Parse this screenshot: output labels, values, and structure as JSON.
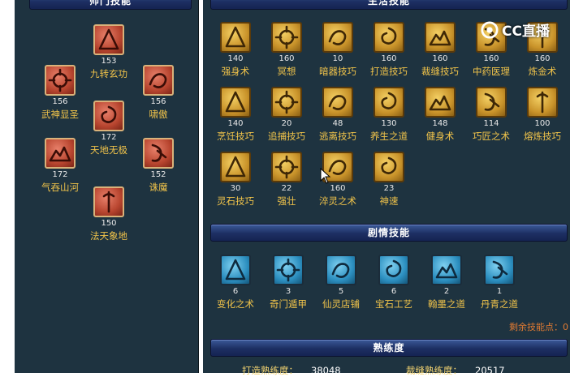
{
  "headers": {
    "school_skills": "师门技能",
    "life_skills": "生活技能",
    "story_skills": "剧情技能",
    "proficiency": "熟练度"
  },
  "school_skills": [
    {
      "level": "153",
      "name": "九转玄功",
      "icon": "spike-icon"
    },
    {
      "level": "156",
      "name": "武神显圣",
      "icon": "burst-icon"
    },
    {
      "level": "156",
      "name": "啸傲",
      "icon": "dragon-icon"
    },
    {
      "level": "172",
      "name": "天地无极",
      "icon": "vortex-icon"
    },
    {
      "level": "172",
      "name": "气吞山河",
      "icon": "mountain-icon"
    },
    {
      "level": "152",
      "name": "诛魔",
      "icon": "claw-icon"
    },
    {
      "level": "150",
      "name": "法天象地",
      "icon": "staff-icon"
    }
  ],
  "life_skills": [
    {
      "level": "140",
      "name": "强身术",
      "icon": "body-icon"
    },
    {
      "level": "160",
      "name": "冥想",
      "icon": "meditate-icon"
    },
    {
      "level": "10",
      "name": "暗器技巧",
      "icon": "dart-icon"
    },
    {
      "level": "160",
      "name": "打造技巧",
      "icon": "forge-icon"
    },
    {
      "level": "160",
      "name": "裁缝技巧",
      "icon": "scissors-icon"
    },
    {
      "level": "160",
      "name": "中药医理",
      "icon": "herb-icon"
    },
    {
      "level": "160",
      "name": "炼金术",
      "icon": "flask-icon"
    },
    {
      "level": "140",
      "name": "烹饪技巧",
      "icon": "pot-icon"
    },
    {
      "level": "20",
      "name": "追捕技巧",
      "icon": "chain-icon"
    },
    {
      "level": "48",
      "name": "逃离技巧",
      "icon": "escape-icon"
    },
    {
      "level": "130",
      "name": "养生之道",
      "icon": "figure-icon"
    },
    {
      "level": "148",
      "name": "健身术",
      "icon": "muscle-icon"
    },
    {
      "level": "114",
      "name": "巧匠之术",
      "icon": "tool-icon"
    },
    {
      "level": "100",
      "name": "熔炼技巧",
      "icon": "furnace-icon"
    },
    {
      "level": "30",
      "name": "灵石技巧",
      "icon": "gem-icon"
    },
    {
      "level": "22",
      "name": "强壮",
      "icon": "strong-icon"
    },
    {
      "level": "160",
      "name": "淬灵之术",
      "icon": "chalice-icon"
    },
    {
      "level": "23",
      "name": "神速",
      "icon": "speed-icon"
    }
  ],
  "story_skills": [
    {
      "level": "6",
      "name": "变化之术",
      "icon": "transform-icon"
    },
    {
      "level": "3",
      "name": "奇门遁甲",
      "icon": "formation-icon"
    },
    {
      "level": "5",
      "name": "仙灵店铺",
      "icon": "shop-icon"
    },
    {
      "level": "6",
      "name": "宝石工艺",
      "icon": "gemcraft-icon"
    },
    {
      "level": "2",
      "name": "翰墨之道",
      "icon": "brush-icon"
    },
    {
      "level": "1",
      "name": "丹青之道",
      "icon": "scroll-icon"
    }
  ],
  "remaining_points": "剩余技能点：0",
  "proficiency": {
    "forge_label": "打造熟练度：",
    "forge_value": "38048",
    "tailor_label": "裁缝熟练度：",
    "tailor_value": "20517"
  },
  "watermark": "CC直播",
  "colors": {
    "panel": "#1e3340",
    "label_gold": "#f0c34a",
    "header_bar": "#1d2f63",
    "remaining": "#e07a32"
  }
}
